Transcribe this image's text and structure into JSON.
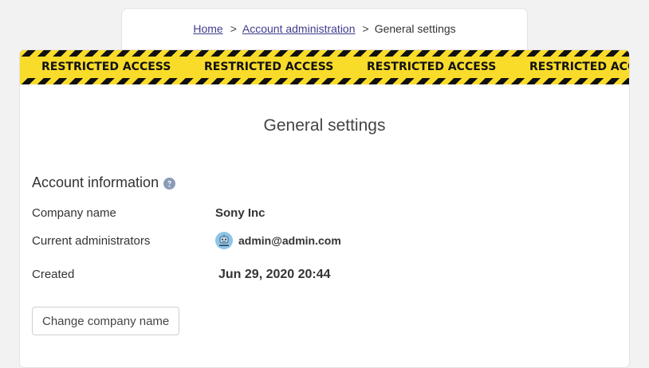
{
  "breadcrumb": {
    "home": "Home",
    "separator": ">",
    "account_admin": "Account administration",
    "current": "General settings"
  },
  "banner": {
    "text": "RESTRICTED ACCESS",
    "stripe_color": "#111111",
    "tape_color": "#f9dc2a"
  },
  "page": {
    "title": "General settings"
  },
  "account_info": {
    "heading": "Account information",
    "help_icon": "question-circle-icon",
    "company_name_label": "Company name",
    "company_name_value": "Sony Inc",
    "administrators_label": "Current administrators",
    "administrators": [
      {
        "email": "admin@admin.com",
        "avatar_icon": "robot-avatar-icon"
      }
    ],
    "created_label": "Created",
    "created_value": "Jun 29, 2020 20:44"
  },
  "actions": {
    "change_company_name": "Change company name"
  },
  "colors": {
    "link": "#3f3d8f",
    "help_icon": "#8a9bb8",
    "avatar_bg": "#8ec5e8"
  }
}
